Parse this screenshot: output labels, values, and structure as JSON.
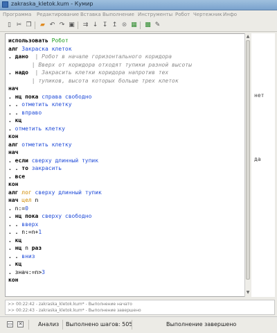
{
  "window": {
    "title": "zakraska_kletok.kum - Кумир"
  },
  "menu": [
    "Программа",
    "Редактирование",
    "Вставка",
    "Выполнение",
    "Инструменты",
    "Робот",
    "Чертежник",
    "Инфо"
  ],
  "toolbar_icons": [
    "new-file-icon",
    "cut-icon",
    "copy-icon",
    "open-file-icon",
    "undo-icon",
    "redo-icon",
    "paste-icon",
    "run-icon",
    "step-icon",
    "step-into-icon",
    "step-out-icon",
    "stop-icon",
    "robot-icon",
    "draw-icon",
    "settings-icon"
  ],
  "code": [
    [
      {
        "t": "использовать ",
        "c": "kw"
      },
      {
        "t": "Робот",
        "c": "gr"
      }
    ],
    [
      {
        "t": "алг ",
        "c": "kw"
      },
      {
        "t": "Закраска клеток",
        "c": "bl"
      }
    ],
    [
      {
        "t": ". ",
        "c": "kw"
      },
      {
        "t": "дано  ",
        "c": "kw"
      },
      {
        "t": "| Робот в начале горизонтального коридора",
        "c": "cm"
      }
    ],
    [
      {
        "t": "       | Вверх от коридора отходят тупики разной высоты",
        "c": "cm"
      }
    ],
    [
      {
        "t": ". ",
        "c": "kw"
      },
      {
        "t": "надо  ",
        "c": "kw"
      },
      {
        "t": "| Закрасить клетки коридора напротив тех",
        "c": "cm"
      }
    ],
    [
      {
        "t": "       | тупиков, высота которых больше трех клеток",
        "c": "cm"
      }
    ],
    [
      {
        "t": "нач",
        "c": "kw"
      }
    ],
    [
      {
        "t": ". ",
        "c": "kw"
      },
      {
        "t": "нц пока ",
        "c": "kw"
      },
      {
        "t": "справа свободно",
        "c": "bl"
      }
    ],
    [
      {
        "t": ". . ",
        "c": "kw"
      },
      {
        "t": "отметить клетку",
        "c": "bl"
      }
    ],
    [
      {
        "t": ". . ",
        "c": "kw"
      },
      {
        "t": "вправо",
        "c": "bl"
      }
    ],
    [
      {
        "t": ". ",
        "c": "kw"
      },
      {
        "t": "кц",
        "c": "kw"
      }
    ],
    [
      {
        "t": ". ",
        "c": "kw"
      },
      {
        "t": "отметить клетку",
        "c": "bl"
      }
    ],
    [
      {
        "t": "кон",
        "c": "kw"
      }
    ],
    [
      {
        "t": "алг ",
        "c": "kw"
      },
      {
        "t": "отметить клетку",
        "c": "bl"
      }
    ],
    [
      {
        "t": "нач",
        "c": "kw"
      }
    ],
    [
      {
        "t": ". ",
        "c": "kw"
      },
      {
        "t": "если ",
        "c": "kw"
      },
      {
        "t": "сверху длинный тупик",
        "c": "bl"
      }
    ],
    [
      {
        "t": ". . ",
        "c": "kw"
      },
      {
        "t": "то ",
        "c": "kw"
      },
      {
        "t": "закрасить",
        "c": "bl"
      }
    ],
    [
      {
        "t": ". ",
        "c": "kw"
      },
      {
        "t": "все",
        "c": "kw"
      }
    ],
    [
      {
        "t": "кон",
        "c": "kw"
      }
    ],
    [
      {
        "t": "алг ",
        "c": "kw"
      },
      {
        "t": "лог ",
        "c": "or"
      },
      {
        "t": "сверху длинный тупик",
        "c": "bl"
      }
    ],
    [
      {
        "t": "нач ",
        "c": "kw"
      },
      {
        "t": "цел ",
        "c": "or"
      },
      {
        "t": "n",
        "c": ""
      }
    ],
    [
      {
        "t": ". ",
        "c": "kw"
      },
      {
        "t": "n:=",
        "c": ""
      },
      {
        "t": "0",
        "c": "bl"
      }
    ],
    [
      {
        "t": ". ",
        "c": "kw"
      },
      {
        "t": "нц пока ",
        "c": "kw"
      },
      {
        "t": "сверху свободно",
        "c": "bl"
      }
    ],
    [
      {
        "t": ". . ",
        "c": "kw"
      },
      {
        "t": "вверх",
        "c": "bl"
      }
    ],
    [
      {
        "t": ". . ",
        "c": "kw"
      },
      {
        "t": "n:=n+",
        "c": ""
      },
      {
        "t": "1",
        "c": "bl"
      }
    ],
    [
      {
        "t": ". ",
        "c": "kw"
      },
      {
        "t": "кц",
        "c": "kw"
      }
    ],
    [
      {
        "t": ". ",
        "c": "kw"
      },
      {
        "t": "нц ",
        "c": "kw"
      },
      {
        "t": "n ",
        "c": ""
      },
      {
        "t": "раз",
        "c": "kw"
      }
    ],
    [
      {
        "t": ". . ",
        "c": "kw"
      },
      {
        "t": "вниз",
        "c": "bl"
      }
    ],
    [
      {
        "t": ". ",
        "c": "kw"
      },
      {
        "t": "кц",
        "c": "kw"
      }
    ],
    [
      {
        "t": ". ",
        "c": "kw"
      },
      {
        "t": "знач:=n>",
        "c": ""
      },
      {
        "t": "3",
        "c": "bl"
      }
    ],
    [
      {
        "t": "кон",
        "c": "kw"
      }
    ]
  ],
  "side_values": [
    {
      "line": 7,
      "text": "нет"
    },
    {
      "line": 15,
      "text": "да"
    }
  ],
  "log": [
    ">> 00:22:42 - zakraska_kletok.kum* - Выполнение начато",
    ">> 00:22:43 - zakraska_kletok.kum* - Выполнение завершено"
  ],
  "status": {
    "analysis": "Анализ",
    "steps": "Выполнено шагов: 505",
    "state": "Выполнение завершено"
  }
}
